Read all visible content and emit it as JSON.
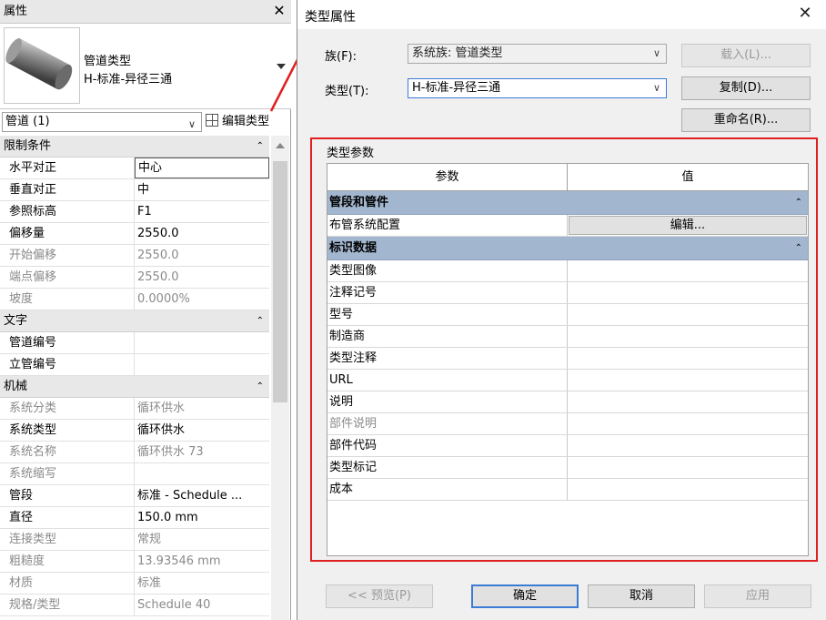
{
  "properties": {
    "title": "属性",
    "close": "✕",
    "type_name_line1": "管道类型",
    "type_name_line2": "H-标准-异径三通",
    "instance_filter": "管道 (1)",
    "edit_type_label": "编辑类型",
    "groups": [
      {
        "label": "限制条件",
        "rows": [
          {
            "key": "水平对正",
            "value": "中心",
            "dim": false,
            "selected": true
          },
          {
            "key": "垂直对正",
            "value": "中",
            "dim": false
          },
          {
            "key": "参照标高",
            "value": "F1",
            "dim": false
          },
          {
            "key": "偏移量",
            "value": "2550.0",
            "dim": false
          },
          {
            "key": "开始偏移",
            "value": "2550.0",
            "dim": true
          },
          {
            "key": "端点偏移",
            "value": "2550.0",
            "dim": true
          },
          {
            "key": "坡度",
            "value": "0.0000%",
            "dim": true
          }
        ]
      },
      {
        "label": "文字",
        "rows": [
          {
            "key": "管道编号",
            "value": "",
            "dim": false
          },
          {
            "key": "立管编号",
            "value": "",
            "dim": false
          }
        ]
      },
      {
        "label": "机械",
        "rows": [
          {
            "key": "系统分类",
            "value": "循环供水",
            "dim": true
          },
          {
            "key": "系统类型",
            "value": "循环供水",
            "dim": false
          },
          {
            "key": "系统名称",
            "value": "循环供水 73",
            "dim": true
          },
          {
            "key": "系统缩写",
            "value": "",
            "dim": true
          },
          {
            "key": "管段",
            "value": "标准 - Schedule ...",
            "dim": false
          },
          {
            "key": "直径",
            "value": "150.0 mm",
            "dim": false
          },
          {
            "key": "连接类型",
            "value": "常规",
            "dim": true
          },
          {
            "key": "粗糙度",
            "value": "13.93546 mm",
            "dim": true
          },
          {
            "key": "材质",
            "value": "标准",
            "dim": true
          },
          {
            "key": "规格/类型",
            "value": "Schedule 40",
            "dim": true
          }
        ]
      }
    ]
  },
  "dialog": {
    "title": "类型属性",
    "close": "✕",
    "family_label": "族(F):",
    "family_value": "系统族: 管道类型",
    "type_label": "类型(T):",
    "type_value": "H-标准-异径三通",
    "load_button": "载入(L)...",
    "duplicate_button": "复制(D)...",
    "rename_button": "重命名(R)...",
    "type_params_label": "类型参数",
    "col_param": "参数",
    "col_value": "值",
    "groups": [
      {
        "label": "管段和管件",
        "rows": [
          {
            "key": "布管系统配置",
            "value_button": "编辑...",
            "dim": false
          }
        ]
      },
      {
        "label": "标识数据",
        "rows": [
          {
            "key": "类型图像",
            "dim": false
          },
          {
            "key": "注释记号",
            "dim": false
          },
          {
            "key": "型号",
            "dim": false
          },
          {
            "key": "制造商",
            "dim": false
          },
          {
            "key": "类型注释",
            "dim": false
          },
          {
            "key": "URL",
            "dim": false
          },
          {
            "key": "说明",
            "dim": false
          },
          {
            "key": "部件说明",
            "dim": true
          },
          {
            "key": "部件代码",
            "dim": false
          },
          {
            "key": "类型标记",
            "dim": false
          },
          {
            "key": "成本",
            "dim": false
          }
        ]
      }
    ],
    "preview_button": "<< 预览(P)",
    "ok_button": "确定",
    "cancel_button": "取消",
    "apply_button": "应用",
    "collapse_glyph": "⌃",
    "highlight_color": "#e02020"
  }
}
